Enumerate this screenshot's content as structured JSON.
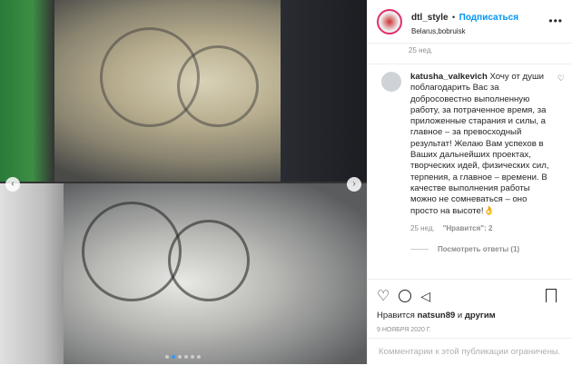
{
  "post": {
    "username": "dtl_style",
    "separator": "•",
    "follow_label": "Подписаться",
    "location": "Belarus,bobruisk",
    "more": "•••"
  },
  "caption_time": "25 нед.",
  "comment": {
    "username": "katusha_valkevich",
    "text": "Хочу от души поблагодарить Вас за добросовестно выполненную работу, за потраченное время, за приложенные старания и силы, а главное – за превосходный результат! Желаю Вам успехов в Ваших дальнейших проектах, творческих идей, физических сил, терпения, а главное – времени. В качестве выполнения работы можно не сомневаться – оно просто на высоте!👌",
    "time": "25 нед.",
    "likes": "\"Нравится\": 2",
    "view_replies": "Посмотреть ответы (1)"
  },
  "likes": {
    "prefix": "Нравится",
    "user": "natsun89",
    "mid": "и",
    "suffix": "другим"
  },
  "date": "9 НОЯБРЯ 2020 Г.",
  "comments_closed": "Комментарии к этой публикации ограничены.",
  "carousel": {
    "count": 6,
    "active": 1,
    "prev": "‹",
    "next": "›"
  },
  "colors": {
    "accent": "#0095f6",
    "dot_active": "#3897f0"
  }
}
